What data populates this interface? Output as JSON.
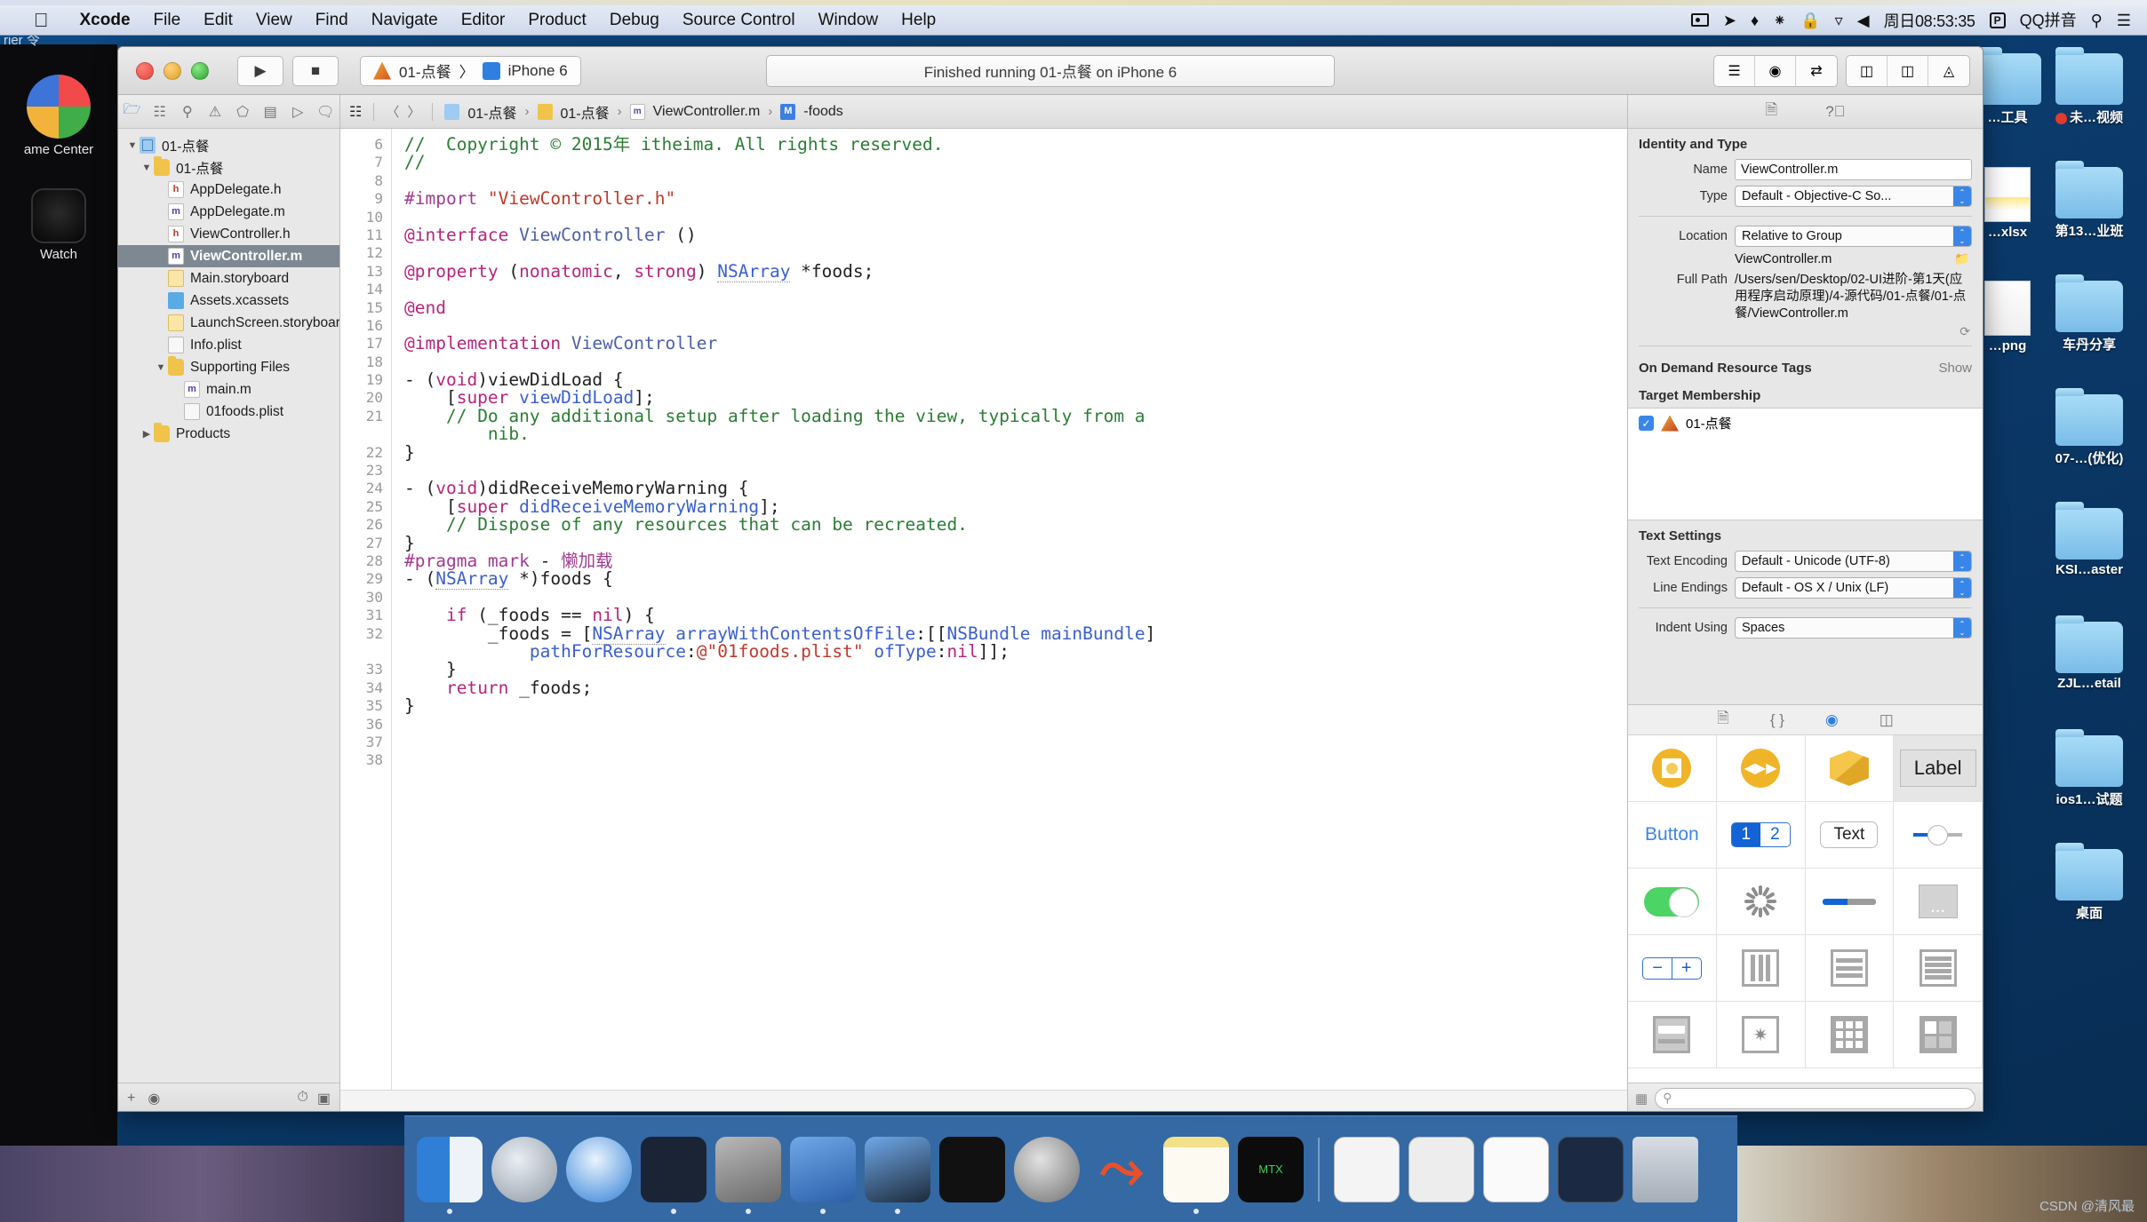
{
  "menubar": {
    "apple": "",
    "items": [
      "Xcode",
      "File",
      "Edit",
      "View",
      "Find",
      "Navigate",
      "Editor",
      "Product",
      "Debug",
      "Source Control",
      "Window",
      "Help"
    ],
    "status_icons": [
      "screen-record-icon",
      "location-icon",
      "bluetooth-icon",
      "airdrop-icon",
      "lock-icon",
      "wifi-icon",
      "volume-icon"
    ],
    "clock": "周日08:53:35",
    "input_badge": "P",
    "input_method": "QQ拼音",
    "search_icon": "search-icon",
    "notification_icon": "notification-center-icon"
  },
  "leftbar": {
    "carrier_text": "rier 令",
    "items": [
      {
        "label": "ame Center"
      },
      {
        "label": "Watch"
      }
    ]
  },
  "xcode": {
    "toolbar": {
      "run_label": "▶",
      "stop_label": "■",
      "scheme_project": "01-点餐",
      "scheme_sep": "〉",
      "scheme_device": "iPhone 6",
      "status": "Finished running 01-点餐 on iPhone 6",
      "right_buttons": [
        "standard-editor-icon",
        "assistant-editor-icon",
        "version-editor-icon",
        "navigator-toggle-icon",
        "debug-toggle-icon",
        "utilities-toggle-icon"
      ]
    },
    "navigator": {
      "tabs": [
        "project-navigator-icon",
        "symbol-navigator-icon",
        "find-navigator-icon",
        "issue-navigator-icon",
        "test-navigator-icon",
        "debug-navigator-icon",
        "breakpoint-navigator-icon",
        "report-navigator-icon"
      ],
      "tree": [
        {
          "label": "01-点餐",
          "icon": "proj",
          "indent": 0,
          "twisty": "▼",
          "selected": false
        },
        {
          "label": "01-点餐",
          "icon": "folder",
          "indent": 1,
          "twisty": "▼",
          "selected": false
        },
        {
          "label": "AppDelegate.h",
          "icon": "h",
          "indent": 2,
          "twisty": "",
          "selected": false
        },
        {
          "label": "AppDelegate.m",
          "icon": "m",
          "indent": 2,
          "twisty": "",
          "selected": false
        },
        {
          "label": "ViewController.h",
          "icon": "h",
          "indent": 2,
          "twisty": "",
          "selected": false
        },
        {
          "label": "ViewController.m",
          "icon": "m",
          "indent": 2,
          "twisty": "",
          "selected": true
        },
        {
          "label": "Main.storyboard",
          "icon": "sb",
          "indent": 2,
          "twisty": "",
          "selected": false
        },
        {
          "label": "Assets.xcassets",
          "icon": "xcassets",
          "indent": 2,
          "twisty": "",
          "selected": false
        },
        {
          "label": "LaunchScreen.storyboard",
          "icon": "sb",
          "indent": 2,
          "twisty": "",
          "selected": false
        },
        {
          "label": "Info.plist",
          "icon": "plist",
          "indent": 2,
          "twisty": "",
          "selected": false
        },
        {
          "label": "Supporting Files",
          "icon": "folder",
          "indent": 2,
          "twisty": "▼",
          "selected": false
        },
        {
          "label": "main.m",
          "icon": "m",
          "indent": 3,
          "twisty": "",
          "selected": false
        },
        {
          "label": "01foods.plist",
          "icon": "plist",
          "indent": 3,
          "twisty": "",
          "selected": false
        },
        {
          "label": "Products",
          "icon": "folder",
          "indent": 1,
          "twisty": "▶",
          "selected": false
        }
      ],
      "bottom": {
        "add": "+",
        "filter": "filter-icon"
      }
    },
    "jumpbar": {
      "related_icon": "related-items-icon",
      "back": "〈",
      "forward": "〉",
      "crumbs": [
        {
          "label": "01-点餐",
          "icon": "proj"
        },
        {
          "label": "01-点餐",
          "icon": "folder"
        },
        {
          "label": "ViewController.m",
          "icon": "m"
        },
        {
          "label": "-foods",
          "icon": "sym"
        }
      ]
    },
    "editor": {
      "first_line_number": 6,
      "lines": [
        {
          "n": 6,
          "html": "<span class='c-com'>//  Copyright © 2015年 itheima. All rights reserved.</span>"
        },
        {
          "n": 7,
          "html": "<span class='c-com'>//</span>"
        },
        {
          "n": 8,
          "html": ""
        },
        {
          "n": 9,
          "html": "<span class='c-pre'>#import </span><span class='c-str'>\"ViewController.h\"</span>"
        },
        {
          "n": 10,
          "html": ""
        },
        {
          "n": 11,
          "html": "<span class='c-kw'>@interface</span> <span class='c-cls'>ViewController</span> ()"
        },
        {
          "n": 12,
          "html": ""
        },
        {
          "n": 13,
          "html": "<span class='c-kw'>@property</span> (<span class='c-kw'>nonatomic</span>, <span class='c-kw'>strong</span>) <span class='c-type uline'>NSArray</span> *foods;"
        },
        {
          "n": 14,
          "html": ""
        },
        {
          "n": 15,
          "html": "<span class='c-kw'>@end</span>"
        },
        {
          "n": 16,
          "html": ""
        },
        {
          "n": 17,
          "html": "<span class='c-kw'>@implementation</span> <span class='c-cls'>ViewController</span>"
        },
        {
          "n": 18,
          "html": ""
        },
        {
          "n": 19,
          "html": "- (<span class='c-kw'>void</span>)viewDidLoad {"
        },
        {
          "n": 20,
          "html": "    [<span class='c-kw'>super</span> <span class='c-type'>viewDidLoad</span>];"
        },
        {
          "n": 21,
          "html": "    <span class='c-com'>// Do any additional setup after loading the view, typically from a</span>"
        },
        {
          "n": "",
          "html": "        <span class='c-com'>nib.</span>"
        },
        {
          "n": 22,
          "html": "}"
        },
        {
          "n": 23,
          "html": ""
        },
        {
          "n": 24,
          "html": "- (<span class='c-kw'>void</span>)didReceiveMemoryWarning {"
        },
        {
          "n": 25,
          "html": "    [<span class='c-kw'>super</span> <span class='c-type'>didReceiveMemoryWarning</span>];"
        },
        {
          "n": 26,
          "html": "    <span class='c-com'>// Dispose of any resources that can be recreated.</span>"
        },
        {
          "n": 27,
          "html": "}"
        },
        {
          "n": 28,
          "html": "<span class='c-pre'>#pragma mark</span> - <span class='c-pre'>懒加载</span>"
        },
        {
          "n": 29,
          "html": "- (<span class='c-type uline'>NSArray</span> *)foods {"
        },
        {
          "n": 30,
          "html": ""
        },
        {
          "n": 31,
          "html": "    <span class='c-kw'>if</span> (_foods == <span class='c-kw'>nil</span>) {"
        },
        {
          "n": 32,
          "html": "        _foods = [<span class='c-type uline'>NSArray</span> <span class='c-type'>arrayWithContentsOfFile</span>:[[<span class='c-type'>NSBundle</span> <span class='c-type'>mainBundle</span>]"
        },
        {
          "n": "",
          "html": "            <span class='c-type'>pathForResource</span>:<span class='c-str'>@\"01foods.plist\"</span> <span class='c-type'>ofType</span>:<span class='c-kw'>nil</span>]];"
        },
        {
          "n": 33,
          "html": "    }"
        },
        {
          "n": 34,
          "html": "    <span class='c-kw'>return</span> _foods;"
        },
        {
          "n": 35,
          "html": "}"
        },
        {
          "n": 36,
          "html": ""
        },
        {
          "n": 37,
          "html": ""
        },
        {
          "n": 38,
          "html": ""
        }
      ]
    },
    "inspector": {
      "tabs": [
        "file-inspector-icon",
        "quick-help-icon"
      ],
      "identity": {
        "title": "Identity and Type",
        "name_label": "Name",
        "name_value": "ViewController.m",
        "type_label": "Type",
        "type_value": "Default - Objective-C So...",
        "location_label": "Location",
        "location_value": "Relative to Group",
        "location_file": "ViewController.m",
        "fullpath_label": "Full Path",
        "fullpath_value": "/Users/sen/Desktop/02-UI进阶-第1天(应用程序启动原理)/4-源代码/01-点餐/01-点餐/ViewController.m"
      },
      "odr": {
        "title": "On Demand Resource Tags",
        "show": "Show"
      },
      "target_membership": {
        "title": "Target Membership",
        "items": [
          {
            "label": "01-点餐",
            "checked": true
          }
        ]
      },
      "text_settings": {
        "title": "Text Settings",
        "encoding_label": "Text Encoding",
        "encoding_value": "Default - Unicode (UTF-8)",
        "endings_label": "Line Endings",
        "endings_value": "Default - OS X / Unix (LF)",
        "indent_label": "Indent Using",
        "indent_value": "Spaces"
      }
    },
    "library": {
      "tabs": [
        "file-template-library-icon",
        "code-snippet-library-icon",
        "object-library-icon",
        "media-library-icon"
      ],
      "active_tab_index": 2,
      "items": [
        {
          "name": "view-controller-object",
          "label": ""
        },
        {
          "name": "storyboard-reference-object",
          "label": ""
        },
        {
          "name": "object-cube",
          "label": ""
        },
        {
          "name": "label-object",
          "label": "Label"
        },
        {
          "name": "button-object",
          "label": "Button"
        },
        {
          "name": "segmented-control-object",
          "label": "1 2"
        },
        {
          "name": "text-field-object",
          "label": "Text"
        },
        {
          "name": "slider-object",
          "label": ""
        },
        {
          "name": "switch-object",
          "label": ""
        },
        {
          "name": "activity-indicator-object",
          "label": ""
        },
        {
          "name": "progress-view-object",
          "label": ""
        },
        {
          "name": "page-control-object",
          "label": ""
        },
        {
          "name": "stepper-object",
          "label": ""
        },
        {
          "name": "horizontal-stack-view-object",
          "label": ""
        },
        {
          "name": "vertical-stack-view-object",
          "label": ""
        },
        {
          "name": "table-view-object",
          "label": ""
        },
        {
          "name": "table-view-cell-object",
          "label": ""
        },
        {
          "name": "image-view-object",
          "label": ""
        },
        {
          "name": "collection-view-object",
          "label": ""
        },
        {
          "name": "collection-view-cell-object",
          "label": ""
        }
      ],
      "search_placeholder": ""
    }
  },
  "desktop": {
    "icons": [
      {
        "label": "…工具",
        "type": "folder",
        "col": 0,
        "row": 0
      },
      {
        "label": "未…视频",
        "type": "folder",
        "col": 1,
        "row": 0,
        "dot": true
      },
      {
        "label": "…xlsx",
        "type": "file",
        "col": 0,
        "row": 1
      },
      {
        "label": "第13…业班",
        "type": "folder",
        "col": 1,
        "row": 1
      },
      {
        "label": "…png",
        "type": "file",
        "col": 0,
        "row": 2
      },
      {
        "label": "车丹分享",
        "type": "folder",
        "col": 1,
        "row": 2
      },
      {
        "label": "07-…(优化)",
        "type": "folder",
        "col": 1,
        "row": 3
      },
      {
        "label": "KSI…aster",
        "type": "folder",
        "col": 1,
        "row": 4
      },
      {
        "label": "ZJL…etail",
        "type": "folder",
        "col": 1,
        "row": 5
      },
      {
        "label": "ios1…试题",
        "type": "folder",
        "col": 1,
        "row": 6
      },
      {
        "label": "桌面",
        "type": "folder",
        "col": 1,
        "row": 7
      }
    ]
  },
  "dock": {
    "items": [
      {
        "name": "finder-icon"
      },
      {
        "name": "launchpad-icon"
      },
      {
        "name": "safari-icon"
      },
      {
        "name": "mouse-app-icon"
      },
      {
        "name": "quicktime-icon"
      },
      {
        "name": "xcode-icon"
      },
      {
        "name": "xcode-beta-icon"
      },
      {
        "name": "terminal-icon"
      },
      {
        "name": "system-preferences-icon"
      },
      {
        "name": "parallels-icon"
      },
      {
        "name": "notes-icon"
      },
      {
        "name": "matrix-icon"
      },
      {
        "name": "doc-window-icon"
      },
      {
        "name": "doc-window2-icon"
      },
      {
        "name": "doc-window3-icon"
      },
      {
        "name": "display-icon"
      },
      {
        "name": "trash-icon"
      }
    ]
  },
  "watermark": "CSDN @清风最"
}
